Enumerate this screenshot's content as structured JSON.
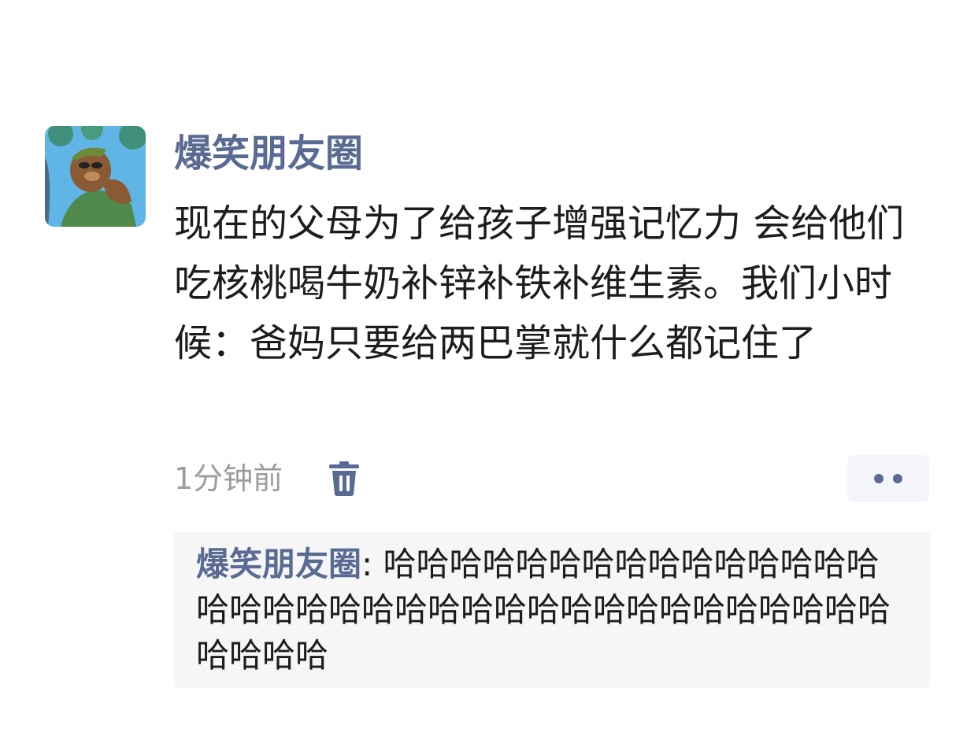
{
  "post": {
    "username": "爆笑朋友圈",
    "text": "现在的父母为了给孩子增强记忆力 会给他们吃核桃喝牛奶补锌补铁补维生素。我们小时候：爸妈只要给两巴掌就什么都记住了",
    "time": "1分钟前",
    "avatar_icon": "cartoon-bear-avatar",
    "delete_icon": "trash-icon",
    "more_icon": "two-dots-icon"
  },
  "comment": {
    "author": "爆笑朋友圈",
    "separator": ": ",
    "text": "哈哈哈哈哈哈哈哈哈哈哈哈哈哈哈哈哈哈哈哈哈哈哈哈哈哈哈哈哈哈哈哈哈哈哈哈哈哈哈哈"
  },
  "colors": {
    "name_blue": "#5a6b93",
    "text": "#1d1d1d",
    "meta_gray": "#9c9c9c",
    "comment_bg": "#f6f6f6"
  }
}
